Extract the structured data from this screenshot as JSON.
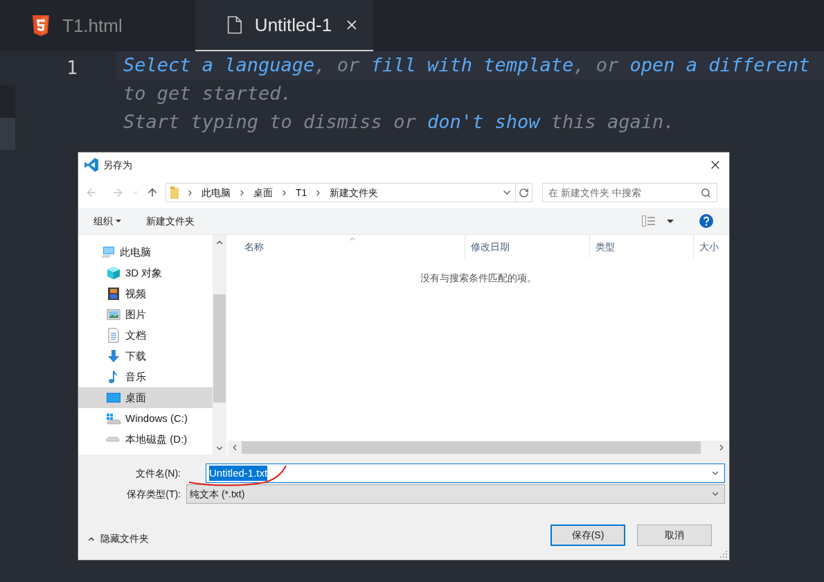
{
  "editor": {
    "tabs": [
      {
        "label": "T1.html",
        "kind": "html",
        "selected": false
      },
      {
        "label": "Untitled-1",
        "kind": "file",
        "selected": true
      }
    ],
    "line_numbers": [
      "1"
    ],
    "hint_lines": [
      [
        {
          "text": "Select a language",
          "kind": "link"
        },
        {
          "text": ", or ",
          "kind": "plain"
        },
        {
          "text": "fill with template",
          "kind": "link"
        },
        {
          "text": ", or ",
          "kind": "plain"
        },
        {
          "text": "open a different",
          "kind": "link"
        }
      ],
      [
        {
          "text": "to get started.",
          "kind": "plain"
        }
      ],
      [
        {
          "text": "Start typing to dismiss or ",
          "kind": "plain"
        },
        {
          "text": "don't show",
          "kind": "link"
        },
        {
          "text": " this again.",
          "kind": "plain"
        }
      ]
    ]
  },
  "dialog": {
    "title": "另存为",
    "breadcrumbs": [
      "此电脑",
      "桌面",
      "T1",
      "新建文件夹"
    ],
    "search": {
      "placeholder": "在 新建文件夹 中搜索"
    },
    "toolbar": [
      {
        "label": "组织",
        "kind": "menu"
      },
      {
        "label": "新建文件夹",
        "kind": "button"
      }
    ],
    "sidebar": [
      {
        "label": "此电脑",
        "kind": "pc",
        "selected": false,
        "children": [
          {
            "label": "3D 对象",
            "kind": "cube",
            "selected": false
          },
          {
            "label": "视频",
            "kind": "video",
            "selected": false
          },
          {
            "label": "图片",
            "kind": "picture",
            "selected": false
          },
          {
            "label": "文档",
            "kind": "document",
            "selected": false
          },
          {
            "label": "下载",
            "kind": "download",
            "selected": false
          },
          {
            "label": "音乐",
            "kind": "music",
            "selected": false
          },
          {
            "label": "桌面",
            "kind": "desktop",
            "selected": true
          },
          {
            "label": "Windows (C:)",
            "kind": "windows-drive",
            "selected": false
          },
          {
            "label": "本地磁盘 (D:)",
            "kind": "drive",
            "selected": false
          }
        ]
      }
    ],
    "columns": [
      "名称",
      "修改日期",
      "类型",
      "大小"
    ],
    "empty_message": "没有与搜索条件匹配的项。",
    "filename": {
      "label": "文件名(N):",
      "value": "Untitled-1.txt"
    },
    "filetype": {
      "label": "保存类型(T):",
      "value": "纯文本 (*.txt)"
    },
    "hide_folders": "隐藏文件夹",
    "buttons": [
      {
        "label": "保存(S)",
        "default": true
      },
      {
        "label": "取消",
        "default": false
      }
    ]
  }
}
